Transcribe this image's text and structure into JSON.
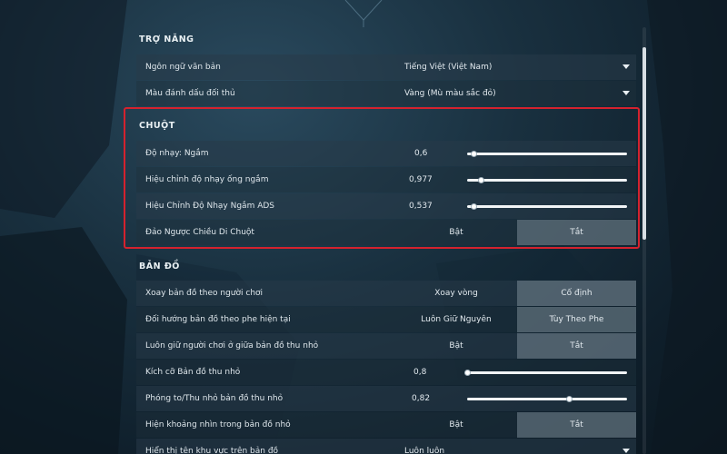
{
  "accessibility": {
    "title": "TRỢ NĂNG",
    "rows": [
      {
        "label": "Ngôn ngữ văn bản",
        "value": "Tiếng Việt (Việt Nam)"
      },
      {
        "label": "Màu đánh dấu đối thủ",
        "value": "Vàng (Mù màu sắc đỏ)"
      }
    ]
  },
  "mouse": {
    "title": "CHUỘT",
    "sensitivity": {
      "label": "Độ nhạy: Ngắm",
      "value": "0,6",
      "fraction": 0.04
    },
    "scope": {
      "label": "Hiệu chỉnh độ nhạy ống ngắm",
      "value": "0,977",
      "fraction": 0.09
    },
    "ads": {
      "label": "Hiệu Chỉnh Độ Nhạy Ngắm ADS",
      "value": "0,537",
      "fraction": 0.04
    },
    "invert": {
      "label": "Đảo Ngược Chiều Di Chuột",
      "on": "Bật",
      "off": "Tắt",
      "selected": "Tắt"
    }
  },
  "map": {
    "title": "BẢN ĐỒ",
    "rotate": {
      "label": "Xoay bản đồ theo người chơi",
      "option_a": "Xoay vòng",
      "option_b": "Cố định",
      "selected": "Cố định"
    },
    "orient": {
      "label": "Đối hướng bản đồ theo phe hiện tại",
      "option_a": "Luôn Giữ Nguyên",
      "option_b": "Tùy Theo Phe",
      "selected": "Tùy Theo Phe"
    },
    "center": {
      "label": "Luôn giữ người chơi ở giữa bản đồ thu nhỏ",
      "on": "Bật",
      "off": "Tắt",
      "selected": "Tắt"
    },
    "size": {
      "label": "Kích cỡ Bản đồ thu nhỏ",
      "value": "0,8",
      "fraction": 0.0
    },
    "zoom": {
      "label": "Phóng to/Thu nhỏ bản đồ thu nhỏ",
      "value": "0,82",
      "fraction": 0.64
    },
    "vision": {
      "label": "Hiện khoảng nhìn trong bản đồ nhỏ",
      "on": "Bật",
      "off": "Tắt",
      "selected": "Tắt"
    },
    "partial": {
      "label": "Hiển thị tên khu vực trên bản đồ",
      "value": "Luôn luôn"
    }
  },
  "colors": {
    "highlight": "#d4222e",
    "selected_toggle": "#788894"
  }
}
